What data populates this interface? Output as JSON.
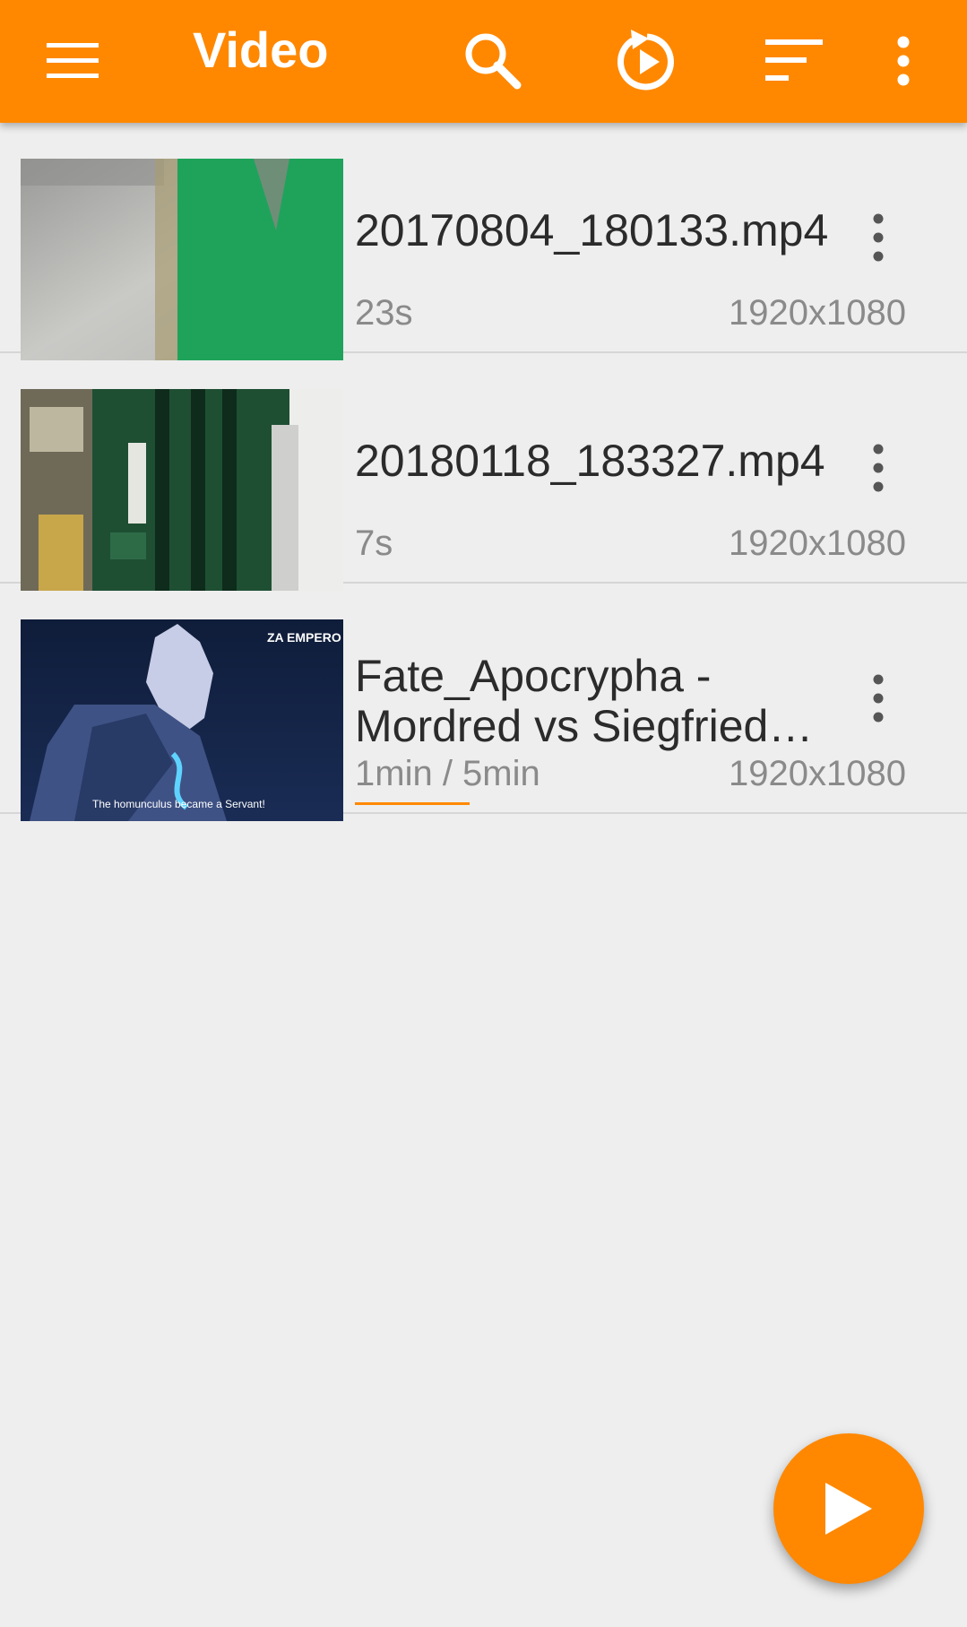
{
  "appbar": {
    "title": "Video",
    "icons": [
      "menu-icon",
      "search-icon",
      "resume-playback-icon",
      "sort-icon",
      "overflow-menu-icon"
    ],
    "color": "#ff8800"
  },
  "videos": [
    {
      "title": "20170804_180133.mp4",
      "duration": "23s",
      "resolution": "1920x1080"
    },
    {
      "title": "20180118_183327.mp4",
      "duration": "7s",
      "resolution": "1920x1080"
    },
    {
      "title": "Fate_Apocrypha - Mordred vs Siegfried…",
      "duration": "1min / 5min",
      "resolution": "1920x1080",
      "progress": 0.2,
      "thumbnail_text": {
        "corner": "ZA EMPERO",
        "subtitle": "The homunculus became a Servant!"
      }
    }
  ],
  "fab": {
    "icon": "play-icon"
  }
}
